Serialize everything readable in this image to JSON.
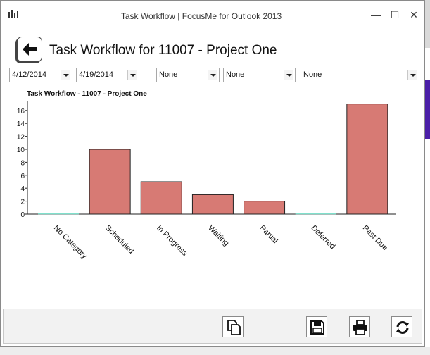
{
  "window": {
    "title": "Task Workflow | FocusMe for Outlook 2013",
    "min_glyph": "—",
    "max_glyph": "☐",
    "close_glyph": "✕"
  },
  "header": {
    "title": "Task Workflow for 11007 - Project One",
    "back_icon": "arrow-left-icon"
  },
  "filters": {
    "start_date": "4/12/2014",
    "end_date": "4/19/2014",
    "filter1": "None",
    "filter2": "None",
    "filter3": "None"
  },
  "chart_data": {
    "type": "bar",
    "title": "Task Workflow - 11007 - Project One",
    "categories": [
      "No Category",
      "Scheduled",
      "In Progress",
      "Waiting",
      "Partial",
      "Deferred",
      "Past Due"
    ],
    "values": [
      0,
      10,
      5,
      3,
      2,
      0,
      17
    ],
    "ylim": [
      0,
      17
    ],
    "yticks": [
      0,
      2,
      4,
      6,
      8,
      10,
      12,
      14,
      16
    ],
    "bar_color": "#d77a74",
    "zero_bar_color": "#7fe0cc"
  },
  "toolbar": {
    "buttons": [
      {
        "name": "copy-button",
        "icon": "copy-icon"
      },
      {
        "name": "save-button",
        "icon": "save-icon"
      },
      {
        "name": "print-button",
        "icon": "print-icon"
      },
      {
        "name": "refresh-button",
        "icon": "refresh-icon"
      }
    ]
  },
  "colors": {
    "accent": "#4b1fa8"
  }
}
